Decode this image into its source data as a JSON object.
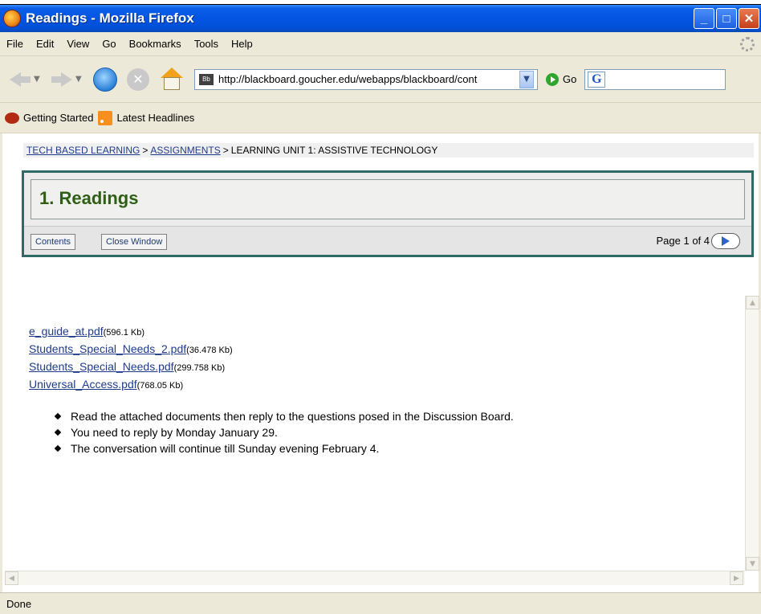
{
  "window": {
    "title": "Readings - Mozilla Firefox"
  },
  "menu": [
    "File",
    "Edit",
    "View",
    "Go",
    "Bookmarks",
    "Tools",
    "Help"
  ],
  "nav": {
    "url": "http://blackboard.goucher.edu/webapps/blackboard/cont",
    "go_label": "Go",
    "site_icon_text": "Bb",
    "search_engine_icon": "G"
  },
  "bookmarks": [
    {
      "label": "Getting Started",
      "icon": "firefox-icon"
    },
    {
      "label": "Latest Headlines",
      "icon": "rss-icon"
    }
  ],
  "breadcrumb": {
    "items": [
      "TECH BASED LEARNING",
      "ASSIGNMENTS",
      "LEARNING UNIT 1: ASSISTIVE TECHNOLOGY"
    ],
    "separator": ">"
  },
  "header": {
    "title": "1. Readings",
    "contents_button": "Contents",
    "close_button": "Close Window",
    "page_indicator": "Page 1 of 4"
  },
  "files": [
    {
      "name": "e_guide_at.pdf",
      "size": "(596.1 Kb)"
    },
    {
      "name": "Students_Special_Needs_2.pdf",
      "size": "(36.478 Kb)"
    },
    {
      "name": "Students_Special_Needs.pdf",
      "size": "(299.758 Kb)"
    },
    {
      "name": "Universal_Access.pdf",
      "size": "(768.05 Kb)"
    }
  ],
  "instructions": [
    "Read the attached documents then reply to the questions posed in the Discussion Board.",
    "You need to reply by Monday January 29.",
    "The conversation will continue till Sunday evening February 4."
  ],
  "status": "Done",
  "colors": {
    "title_bar": "#0354e2",
    "panel_border": "#2f6b65",
    "heading": "#2e5f14",
    "link": "#1f3c8c"
  }
}
